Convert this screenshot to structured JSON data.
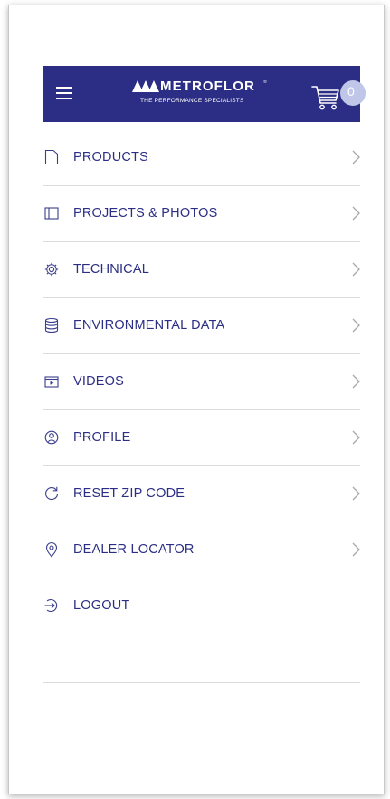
{
  "header": {
    "brand_name": "METROFLOR",
    "brand_reg": "®",
    "brand_tagline": "THE PERFORMANCE SPECIALISTS",
    "cart_count": "0",
    "bar_color": "#2b2e84"
  },
  "menu": {
    "items": [
      {
        "label": "PRODUCTS",
        "icon": "products-icon"
      },
      {
        "label": "PROJECTS & PHOTOS",
        "icon": "photos-icon"
      },
      {
        "label": "TECHNICAL",
        "icon": "gear-icon"
      },
      {
        "label": "ENVIRONMENTAL DATA",
        "icon": "database-icon"
      },
      {
        "label": "VIDEOS",
        "icon": "video-icon"
      },
      {
        "label": "PROFILE",
        "icon": "profile-icon"
      },
      {
        "label": "RESET ZIP CODE",
        "icon": "refresh-icon"
      },
      {
        "label": "DEALER LOCATOR",
        "icon": "location-pin-icon"
      },
      {
        "label": "LOGOUT",
        "icon": "logout-icon"
      }
    ]
  },
  "colors": {
    "accent": "#2b2e84",
    "badge": "#bfc6e8",
    "divider": "#dcdcdc",
    "chevron": "#a8a8a8"
  }
}
